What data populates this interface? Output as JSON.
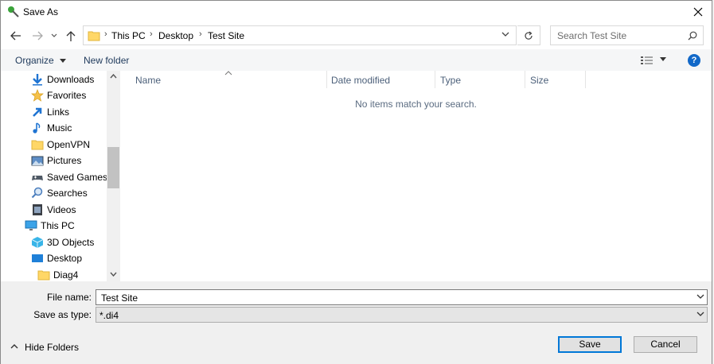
{
  "window": {
    "title": "Save As"
  },
  "nav": {
    "breadcrumbs": [
      "This PC",
      "Desktop",
      "Test Site"
    ],
    "search_placeholder": "Search Test Site"
  },
  "toolbar": {
    "organize": "Organize",
    "new_folder": "New folder"
  },
  "sidebar": {
    "items": [
      {
        "label": "Downloads",
        "icon": "downloads-icon"
      },
      {
        "label": "Favorites",
        "icon": "favorites-icon"
      },
      {
        "label": "Links",
        "icon": "links-icon"
      },
      {
        "label": "Music",
        "icon": "music-icon"
      },
      {
        "label": "OpenVPN",
        "icon": "folder-icon"
      },
      {
        "label": "Pictures",
        "icon": "pictures-icon"
      },
      {
        "label": "Saved Games",
        "icon": "saved-games-icon"
      },
      {
        "label": "Searches",
        "icon": "searches-icon"
      },
      {
        "label": "Videos",
        "icon": "videos-icon"
      },
      {
        "label": "This PC",
        "icon": "this-pc-icon"
      },
      {
        "label": "3D Objects",
        "icon": "3d-objects-icon"
      },
      {
        "label": "Desktop",
        "icon": "desktop-icon"
      },
      {
        "label": "Diag4",
        "icon": "folder-icon"
      }
    ]
  },
  "filelist": {
    "columns": [
      "Name",
      "Date modified",
      "Type",
      "Size"
    ],
    "empty_message": "No items match your search."
  },
  "form": {
    "file_name_label": "File name:",
    "file_name_value": "Test Site",
    "save_type_label": "Save as type:",
    "save_type_value": "*.di4"
  },
  "footer": {
    "hide_folders": "Hide Folders",
    "save": "Save",
    "cancel": "Cancel"
  },
  "colors": {
    "accent": "#0078d7",
    "folder": "#ffd767",
    "help": "#1168c8"
  }
}
